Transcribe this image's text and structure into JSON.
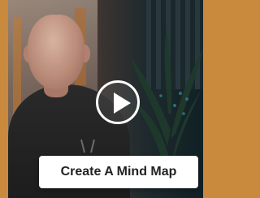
{
  "video": {
    "play_icon": "play-icon",
    "cta_label": "Create A Mind Map"
  },
  "colors": {
    "frame": "#c98a3e",
    "cta_background": "#ffffff",
    "cta_text": "#222222",
    "play_icon": "#ffffff"
  }
}
